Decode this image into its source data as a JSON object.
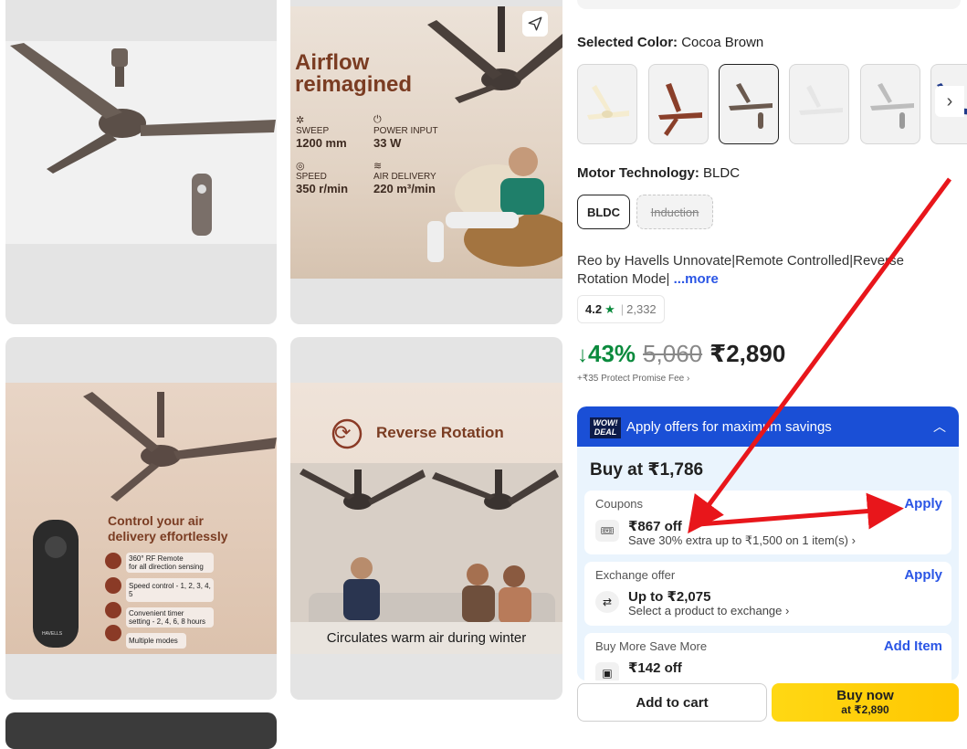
{
  "gallery": {
    "tile2": {
      "headline_1": "Airflow",
      "headline_2": "reimagined",
      "specs": [
        {
          "label": "SWEEP",
          "value": "1200 mm"
        },
        {
          "label": "POWER INPUT",
          "value": "33 W"
        },
        {
          "label": "SPEED",
          "value": "350 r/min"
        },
        {
          "label": "AIR DELIVERY",
          "value": "220 m³/min"
        }
      ]
    },
    "tile3": {
      "headline_1": "Control your air",
      "headline_2": "delivery effortlessly",
      "features": [
        "360° RF Remote",
        "for all direction sensing",
        "Speed control - 1, 2, 3, 4, 5",
        "Convenient timer",
        "setting - 2, 4, 6, 8 hours",
        "Multiple modes"
      ],
      "remote_brand": "HAVELLS"
    },
    "tile4": {
      "headline": "Reverse Rotation",
      "caption": "Circulates warm air during winter"
    }
  },
  "product": {
    "selected_color_label": "Selected Color:",
    "selected_color_value": "Cocoa Brown",
    "motor_label": "Motor Technology:",
    "motor_value": "BLDC",
    "motor_options": [
      "BLDC",
      "Induction"
    ],
    "title_line1": "Reo by Havells Unnovate|Remote Controlled|Reverse",
    "title_line2": "Rotation Mode|",
    "more_link": "...more",
    "rating": "4.2",
    "rating_count": "2,332",
    "discount": "43%",
    "mrp": "5,060",
    "price": "₹2,890",
    "protect_fee": "+₹35 Protect Promise Fee",
    "swatch_colors": [
      "#f5ecd0",
      "#8a3f2a",
      "#6b5a4f",
      "#efefef",
      "#cfcfcf",
      "#1f3a8a"
    ]
  },
  "offers": {
    "badge_1": "WOW!",
    "badge_2": "DEAL",
    "header": "Apply offers for maximum savings",
    "buy_at": "Buy at ₹1,786",
    "coupons": {
      "title": "Coupons",
      "amount": "₹867 off",
      "desc": "Save 30% extra up to ₹1,500 on 1 item(s)",
      "action": "Apply"
    },
    "exchange": {
      "title": "Exchange offer",
      "amount": "Up to ₹2,075",
      "desc": "Select a product to exchange",
      "action": "Apply"
    },
    "bmsm": {
      "title": "Buy More Save More",
      "amount": "₹142 off",
      "action": "Add Item"
    }
  },
  "footer": {
    "add_to_cart": "Add to cart",
    "buy_now": "Buy now",
    "buy_now_price": "at ₹2,890"
  },
  "colors": {
    "accent_blue": "#2a55e5",
    "discount_green": "#0b8a3d",
    "annotation_red": "#e8161b"
  }
}
